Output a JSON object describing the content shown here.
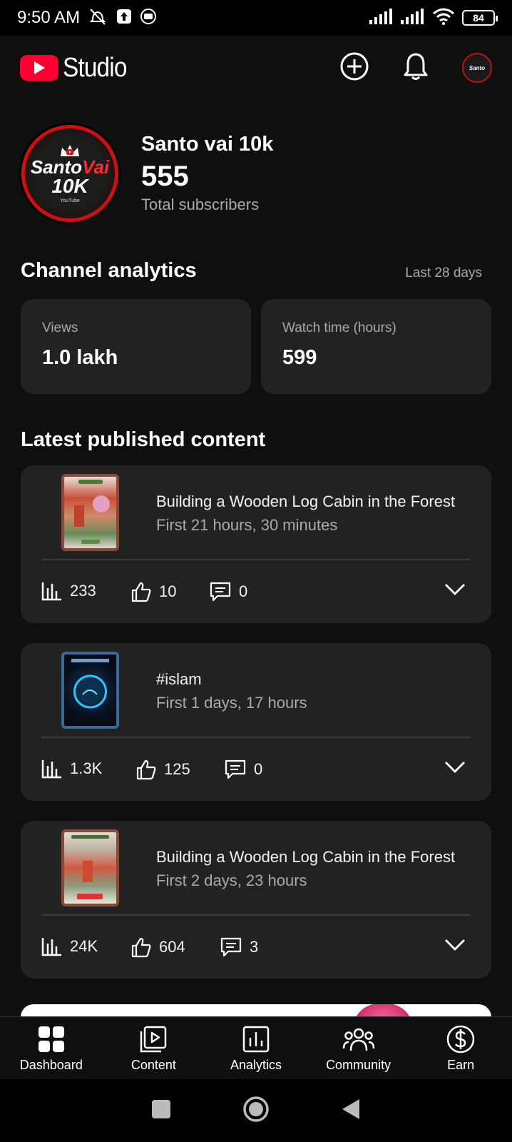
{
  "status_bar": {
    "time": "9:50 AM",
    "battery": "84"
  },
  "header": {
    "brand": "Studio",
    "icons": [
      "create-icon",
      "bell-icon",
      "account-avatar"
    ]
  },
  "channel": {
    "name": "Santo vai 10k",
    "subscribers": "555",
    "subscribers_label": "Total subscribers",
    "avatar_text": {
      "line1a": "Santo",
      "line1b": "Vai",
      "line2": "10K",
      "line3": "YouTube"
    }
  },
  "analytics": {
    "title": "Channel analytics",
    "period": "Last 28 days",
    "cards": [
      {
        "label": "Views",
        "value": "1.0 lakh"
      },
      {
        "label": "Watch time (hours)",
        "value": "599"
      }
    ]
  },
  "latest": {
    "title": "Latest published content",
    "items": [
      {
        "title": "Building a Wooden Log Cabin in the Forest",
        "subtitle": "First 21 hours, 30 minutes",
        "views": "233",
        "likes": "10",
        "comments": "0"
      },
      {
        "title": "#islam",
        "subtitle": "First 1 days, 17 hours",
        "views": "1.3K",
        "likes": "125",
        "comments": "0"
      },
      {
        "title": "Building a Wooden Log Cabin in the Forest",
        "subtitle": "First 2 days, 23 hours",
        "views": "24K",
        "likes": "604",
        "comments": "3"
      }
    ]
  },
  "bottom_nav": [
    {
      "label": "Dashboard",
      "icon": "dashboard-icon"
    },
    {
      "label": "Content",
      "icon": "content-icon"
    },
    {
      "label": "Analytics",
      "icon": "analytics-icon"
    },
    {
      "label": "Community",
      "icon": "community-icon"
    },
    {
      "label": "Earn",
      "icon": "earn-icon"
    }
  ],
  "colors": {
    "brand_red": "#ff0033",
    "background": "#0f0f0f",
    "card": "#222222",
    "secondary_text": "#aaaaaa"
  }
}
